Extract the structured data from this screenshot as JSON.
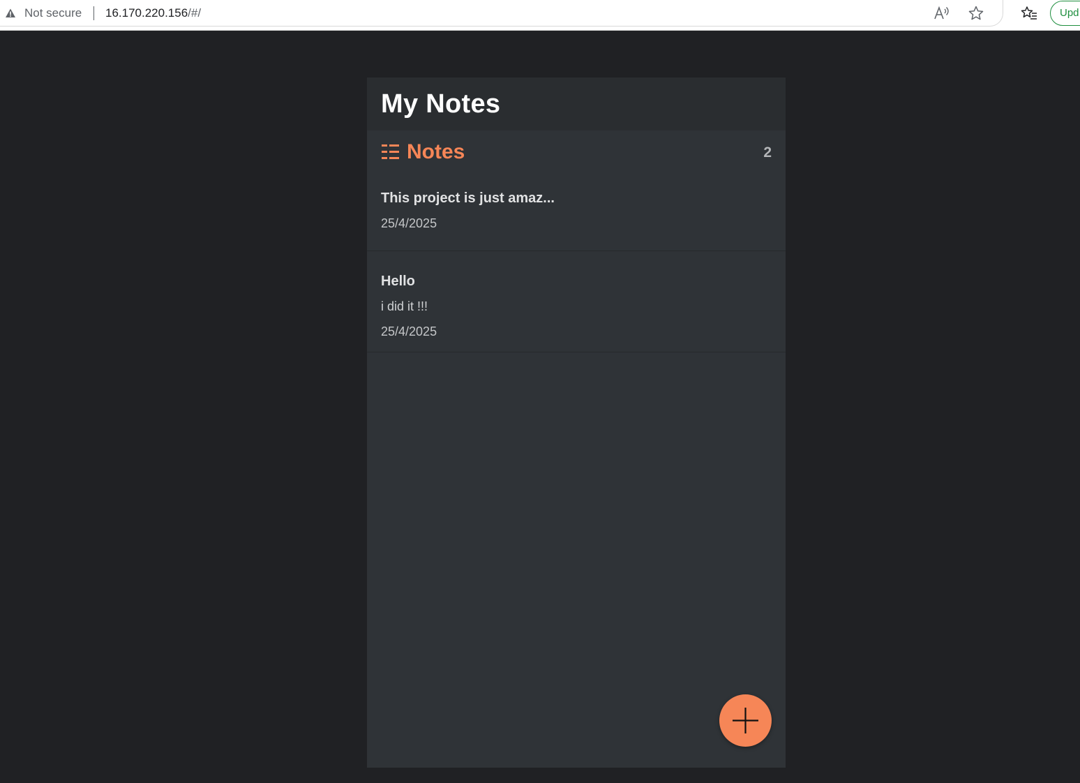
{
  "browser": {
    "security_label": "Not secure",
    "url_host": "16.170.220.156",
    "url_path": "/#/",
    "update_label": "Upd",
    "icons": [
      "warning-icon",
      "read-aloud-icon",
      "star-icon",
      "favorites-icon"
    ]
  },
  "app": {
    "title": "My Notes",
    "notes_section": {
      "title": "Notes",
      "count": "2",
      "icon": "list-icon",
      "accent_color": "#f68657"
    },
    "notes": [
      {
        "title": "This project is just amaz...",
        "body": "",
        "date": "25/4/2025"
      },
      {
        "title": "Hello",
        "body": "i did it !!!",
        "date": "25/4/2025"
      }
    ],
    "add_button": {
      "icon": "plus-icon"
    }
  },
  "colors": {
    "page_background": "#202124",
    "app_background": "#2f3337",
    "header_background": "#2a2d30",
    "accent": "#f68657"
  }
}
